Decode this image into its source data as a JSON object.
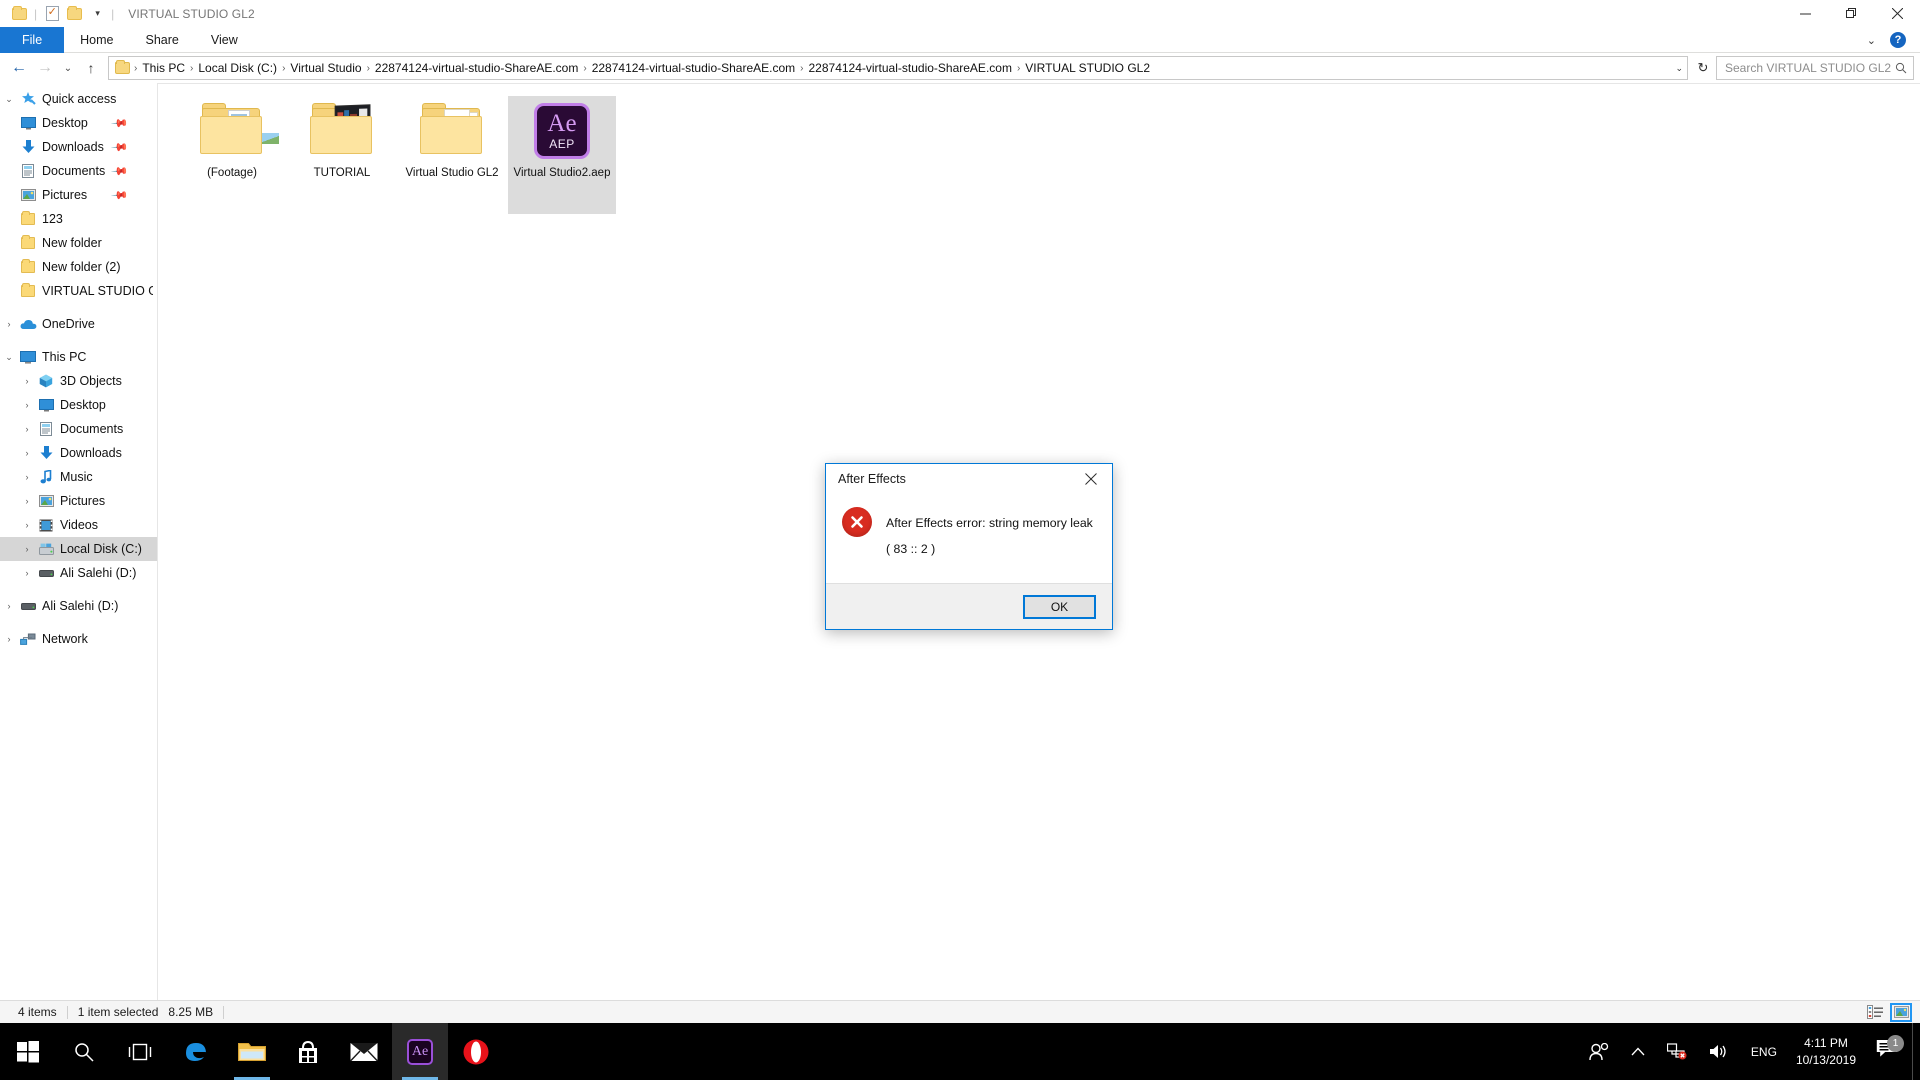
{
  "window": {
    "title": "VIRTUAL STUDIO GL2",
    "quick_access_toolbar": [
      "folder-icon",
      "properties-icon",
      "new-folder-icon",
      "customize-chevron-icon"
    ],
    "controls": {
      "minimize": "—",
      "restore": "❐",
      "close": "✕"
    }
  },
  "ribbon": {
    "tabs": [
      {
        "label": "File",
        "active": true
      },
      {
        "label": "Home",
        "active": false
      },
      {
        "label": "Share",
        "active": false
      },
      {
        "label": "View",
        "active": false
      }
    ],
    "collapse_label": "⌄",
    "help_label": "?"
  },
  "addressbar": {
    "back_label": "←",
    "forward_label": "→",
    "recent_label": "⌄",
    "up_label": "↑",
    "breadcrumbs": [
      "This PC",
      "Local Disk (C:)",
      "Virtual Studio",
      "22874124-virtual-studio-ShareAE.com",
      "22874124-virtual-studio-ShareAE.com",
      "22874124-virtual-studio-ShareAE.com",
      "VIRTUAL STUDIO GL2"
    ],
    "separator": "›",
    "dropdown_label": "⌄",
    "refresh_label": "↻"
  },
  "search": {
    "placeholder": "Search VIRTUAL STUDIO GL2",
    "icon": "search-icon"
  },
  "sidebar": {
    "sections": [
      {
        "name": "quick-access",
        "expander": "⌄",
        "label": "Quick access",
        "icon": "star-pin-icon",
        "items": [
          {
            "label": "Desktop",
            "icon": "desktop-icon",
            "pinned": true,
            "expander": ""
          },
          {
            "label": "Downloads",
            "icon": "downloads-icon",
            "pinned": true,
            "expander": ""
          },
          {
            "label": "Documents",
            "icon": "documents-icon",
            "pinned": true,
            "expander": ""
          },
          {
            "label": "Pictures",
            "icon": "pictures-icon",
            "pinned": true,
            "expander": ""
          },
          {
            "label": "123",
            "icon": "folder-icon",
            "pinned": false,
            "expander": ""
          },
          {
            "label": "New folder",
            "icon": "folder-icon",
            "pinned": false,
            "expander": ""
          },
          {
            "label": "New folder (2)",
            "icon": "folder-icon",
            "pinned": false,
            "expander": ""
          },
          {
            "label": "VIRTUAL STUDIO Gl",
            "icon": "folder-icon",
            "pinned": false,
            "expander": ""
          }
        ]
      },
      {
        "name": "onedrive",
        "expander": "›",
        "label": "OneDrive",
        "icon": "cloud-icon",
        "items": []
      },
      {
        "name": "this-pc",
        "expander": "⌄",
        "label": "This PC",
        "icon": "pc-icon",
        "items": [
          {
            "label": "3D Objects",
            "icon": "3d-objects-icon",
            "expander": "›"
          },
          {
            "label": "Desktop",
            "icon": "desktop-icon",
            "expander": "›"
          },
          {
            "label": "Documents",
            "icon": "documents-icon",
            "expander": "›"
          },
          {
            "label": "Downloads",
            "icon": "downloads-icon",
            "expander": "›"
          },
          {
            "label": "Music",
            "icon": "music-icon",
            "expander": "›"
          },
          {
            "label": "Pictures",
            "icon": "pictures-icon",
            "expander": "›"
          },
          {
            "label": "Videos",
            "icon": "videos-icon",
            "expander": "›"
          },
          {
            "label": "Local Disk (C:)",
            "icon": "harddrive-icon",
            "expander": "›",
            "selected": true
          },
          {
            "label": "Ali Salehi (D:)",
            "icon": "drive-icon",
            "expander": "›"
          }
        ]
      },
      {
        "name": "ali-salehi-d",
        "expander": "›",
        "label": "Ali Salehi (D:)",
        "icon": "drive-icon",
        "items": []
      },
      {
        "name": "network",
        "expander": "›",
        "label": "Network",
        "icon": "network-icon",
        "items": []
      }
    ]
  },
  "files": [
    {
      "name": "(Footage)",
      "type": "folder-with-documents",
      "selected": false
    },
    {
      "name": "TUTORIAL",
      "type": "folder-with-media",
      "selected": false
    },
    {
      "name": "Virtual Studio GL2",
      "type": "folder-with-papers",
      "selected": false
    },
    {
      "name": "Virtual Studio2.aep",
      "type": "after-effects-project",
      "badge_top": "Ae",
      "badge_bottom": "AEP",
      "selected": true
    }
  ],
  "statusbar": {
    "item_count": "4 items",
    "selection": "1 item selected",
    "size": "8.25 MB",
    "views": [
      {
        "name": "details-view",
        "active": false
      },
      {
        "name": "large-icons-view",
        "active": true
      }
    ]
  },
  "dialog": {
    "title": "After Effects",
    "close_label": "✕",
    "icon": "error-icon",
    "message_line1": "After Effects error: string memory leak",
    "message_line2": "( 83 :: 2 )",
    "ok_label": "OK"
  },
  "taskbar": {
    "buttons": [
      {
        "name": "start-button",
        "icon": "windows-logo-icon"
      },
      {
        "name": "search-button",
        "icon": "search-icon"
      },
      {
        "name": "task-view-button",
        "icon": "task-view-icon"
      },
      {
        "name": "edge-button",
        "icon": "edge-icon"
      },
      {
        "name": "file-explorer-button",
        "icon": "folder-icon",
        "running": true
      },
      {
        "name": "microsoft-store-button",
        "icon": "store-icon"
      },
      {
        "name": "mail-button",
        "icon": "mail-icon"
      },
      {
        "name": "after-effects-button",
        "icon": "after-effects-icon",
        "active": true
      },
      {
        "name": "opera-button",
        "icon": "opera-icon"
      }
    ],
    "tray": {
      "people_icon": "people-icon",
      "chevron_icon": "show-hidden-icons-icon",
      "network_icon": "network-error-icon",
      "volume_icon": "volume-icon",
      "language": "ENG",
      "time": "4:11 PM",
      "date": "10/13/2019",
      "notification_count": "1"
    }
  },
  "colors": {
    "accent": "#0078d7",
    "file_tab": "#1976d2",
    "error_red": "#d82c20",
    "selection": "#cfe4f7",
    "taskbar": "#000000"
  }
}
